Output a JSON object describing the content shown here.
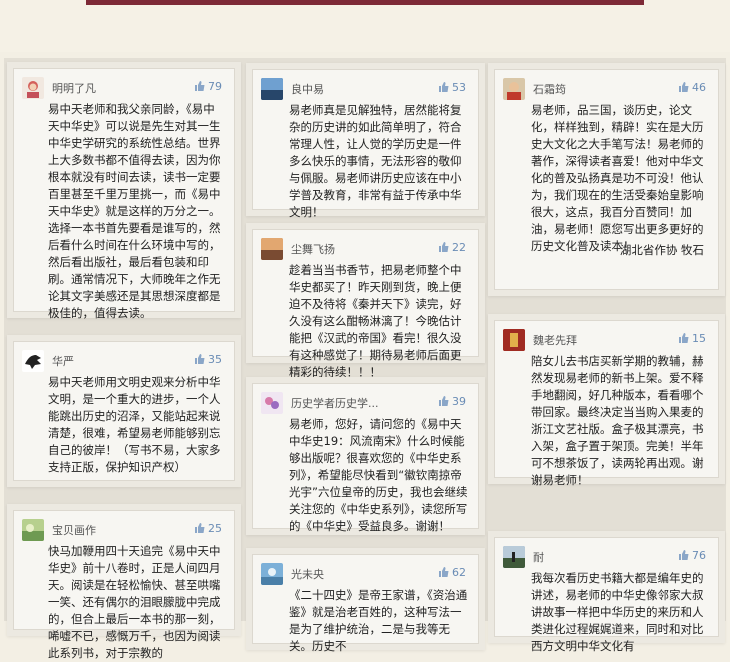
{
  "comments": [
    {
      "name": "明明了凡",
      "likes": "79",
      "text": "易中天老师和我父亲同龄，《易中天中华史》可以说是先生对其一生中华史学研究的系统性总结。世界上大多数书都不值得去读，因为你根本就没有时间去读，读书一定要百里甚至千里万里挑一，而《易中天中华史》就是这样的万分之一。\n选择一本书首先要看是谁写的，然后看什么时间在什么环境中写的，然后看出版社，最后看包装和印刷。通常情况下，大师晚年之作无论其文字美感还是其思想深度都是极佳的，值得去读。"
    },
    {
      "name": "华严",
      "likes": "35",
      "text": "易中天老师用文明史观来分析中华文明，是一个重大的进步，一个人能跳出历史的沼泽，又能站起来说清楚，很难，希望易老师能够别忘自己的彼岸！（写书不易，大家多支持正版，保护知识产权）"
    },
    {
      "name": "宝贝画作",
      "likes": "25",
      "text": "快马加鞭用四十天追完《易中天中华史》前十八卷时，正是人间四月天。阅读是在轻松愉快、甚至哄嘴一笑、还有偶尔的泪眼朦胧中完成的，但合上最后一本书的那一刻，唏嘘不已，感慨万千，也因为阅读此系列书，对于宗教的"
    },
    {
      "name": "良中易",
      "likes": "53",
      "text": "易老师真是见解独特，居然能将复杂的历史讲的如此简单明了，符合常理人性，让人觉的学历史是一件多么快乐的事情，无法形容的敬仰与佩服。易老师讲历史应该在中小学普及教育，非常有益于传承中华文明！"
    },
    {
      "name": "尘舞飞扬",
      "likes": "22",
      "text": "趁着当当书香节，把易老师整个中华史都买了！昨天刚到货，晚上便迫不及待将《秦并天下》读完，好久没有这么酣畅淋漓了！今晚估计能把《汉武的帝国》看完！很久没有这种感觉了！期待易老师后面更精彩的待续！！！"
    },
    {
      "name": "历史学者历史学...",
      "likes": "39",
      "text": "易老师，您好，请问您的《易中天中华史19：风流南宋》什么时候能够出版呢？很喜欢您的《中华史系列》，希望能尽快看到“徽钦南掠帝光宇”六位皇帝的历史，我也会继续关注您的《中华史系列》，读您所写的《中华史》受益良多。谢谢！"
    },
    {
      "name": "光未央",
      "likes": "62",
      "text": "《二十四史》是帝王家谱，《资治通鉴》就是治老百姓的，这种写法一是为了维护统治，二是与我等无关。历史不"
    },
    {
      "name": "石霜筠",
      "likes": "46",
      "text": "易老师，品三国，谈历史，论文化，样样独到，精辟！实在是大历史大文化之大手笔写法！易老师的著作，深得读者喜爱！他对中华文化的普及弘扬真是功不可没！他认为，我们现在的生活受秦始皇影响很大，这点，我百分百赞同！加油，易老师！愿您写出更多更好的历史文化普及读本！",
      "signature": "湖北省作协 牧石"
    },
    {
      "name": "魏老先拜",
      "likes": "15",
      "text": "陪女儿去书店买新学期的教辅，赫然发现易老师的新书上架。爱不释手地翻阅，好几种版本，看看哪个带回家。最终决定当当购入果麦的浙江文艺社版。盒子极其漂亮，书入架，盒子置于架顶。完美！半年可不想茶饭了，读两轮再出观。谢谢易老师！"
    },
    {
      "name": "耐",
      "likes": "76",
      "text": "我每次看历史书籍大都是编年史的讲述，易老师的中华史像邻家大叔讲故事一样把中华历史的来历和人类进化过程娓娓道来，同时和对比西方文明中华文化有"
    }
  ]
}
